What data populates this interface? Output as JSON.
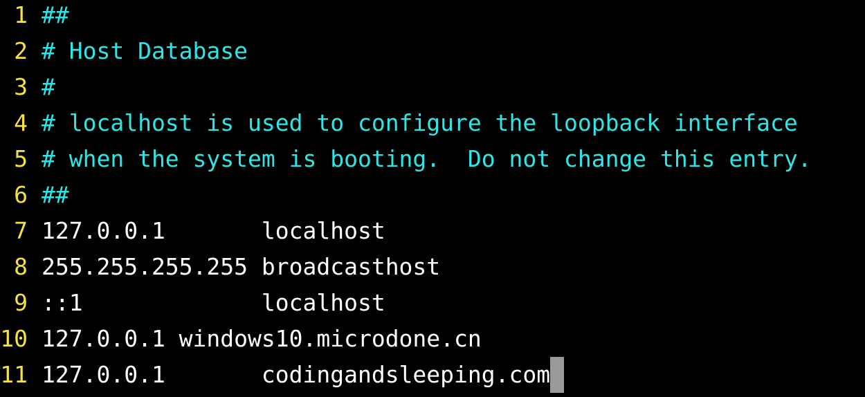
{
  "editor": {
    "colors": {
      "background": "#000000",
      "line_number": "#f4e23f",
      "comment": "#2ee6e6",
      "text": "#ffffff",
      "cursor": "#9a9a9a"
    },
    "lines": [
      {
        "num": "1",
        "text": "##",
        "type": "comment"
      },
      {
        "num": "2",
        "text": "# Host Database",
        "type": "comment"
      },
      {
        "num": "3",
        "text": "#",
        "type": "comment"
      },
      {
        "num": "4",
        "text": "# localhost is used to configure the loopback interface",
        "type": "comment"
      },
      {
        "num": "5",
        "text": "# when the system is booting.  Do not change this entry.",
        "type": "comment"
      },
      {
        "num": "6",
        "text": "##",
        "type": "comment"
      },
      {
        "num": "7",
        "text": "127.0.0.1       localhost",
        "type": "text"
      },
      {
        "num": "8",
        "text": "255.255.255.255 broadcasthost",
        "type": "text"
      },
      {
        "num": "9",
        "text": "::1             localhost",
        "type": "text"
      },
      {
        "num": "10",
        "text": "127.0.0.1 windows10.microdone.cn",
        "type": "text"
      },
      {
        "num": "11",
        "text": "127.0.0.1       codingandsleeping.com",
        "type": "text"
      }
    ]
  }
}
